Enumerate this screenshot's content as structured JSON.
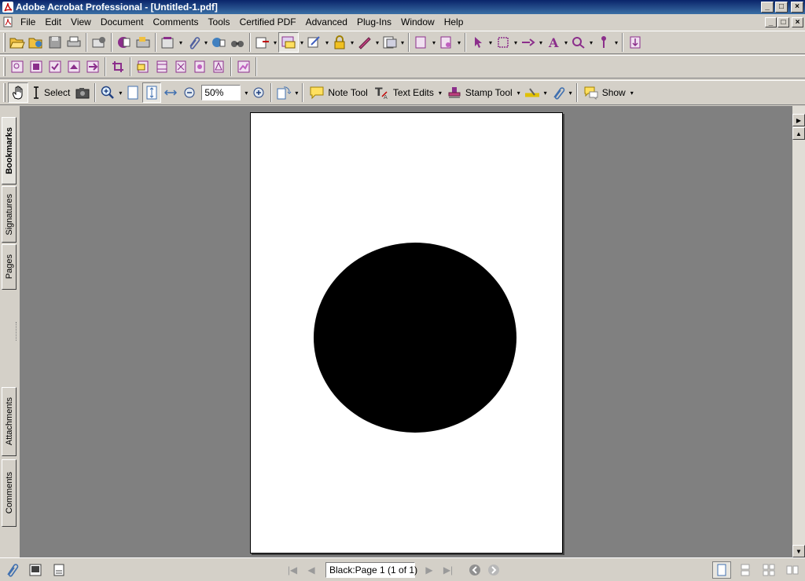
{
  "window": {
    "title": "Adobe Acrobat Professional - [Untitled-1.pdf]",
    "controls": {
      "minimize": "_",
      "maximize": "□",
      "close": "×"
    }
  },
  "menubar": {
    "items": [
      "File",
      "Edit",
      "View",
      "Document",
      "Comments",
      "Tools",
      "Certified PDF",
      "Advanced",
      "Plug-Ins",
      "Window",
      "Help"
    ]
  },
  "toolbar": {
    "select_label": "Select",
    "zoom_value": "50%",
    "note_tool_label": "Note Tool",
    "text_edits_label": "Text Edits",
    "stamp_tool_label": "Stamp Tool",
    "show_label": "Show"
  },
  "nav_tabs": [
    "Bookmarks",
    "Signatures",
    "Pages",
    "Attachments",
    "Comments"
  ],
  "statusbar": {
    "page_indicator": "Black:Page 1  (1 of 1)"
  },
  "colors": {
    "title_bar": "#0a246a",
    "chrome": "#d4d0c8",
    "workspace": "#808080",
    "acrobat_purple": "#8b2e8b",
    "shape_fill": "#000000"
  },
  "document": {
    "shape": "ellipse"
  }
}
